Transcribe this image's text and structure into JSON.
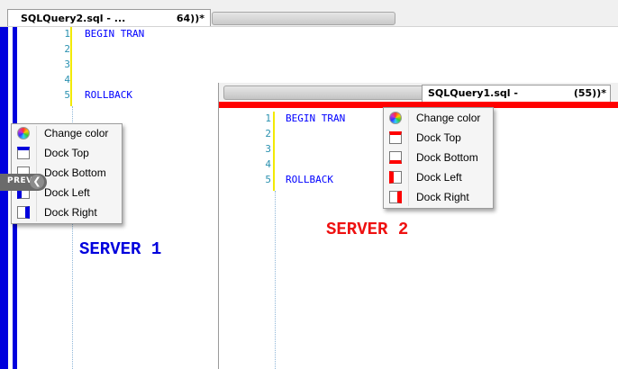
{
  "server1": {
    "tab_title": "SQLQuery2.sql - ...",
    "tab_suffix": "64))*",
    "line_numbers": [
      "1",
      "2",
      "3",
      "4",
      "5"
    ],
    "code_lines": [
      "BEGIN TRAN",
      "",
      "",
      "",
      "ROLLBACK"
    ],
    "label": "SERVER 1",
    "accent_color": "#0000dd"
  },
  "server2": {
    "tab_title": "SQLQuery1.sql -",
    "tab_suffix": "(55))*",
    "line_numbers": [
      "1",
      "2",
      "3",
      "4",
      "5"
    ],
    "code_lines": [
      "BEGIN TRAN",
      "",
      "",
      "",
      "ROLLBACK"
    ],
    "label": "SERVER 2",
    "accent_color": "#ff0000"
  },
  "menu1": {
    "items": [
      {
        "label": "Change color",
        "icon": "color-wheel-icon"
      },
      {
        "label": "Dock Top",
        "icon": "dock-top-icon"
      },
      {
        "label": "Dock Bottom",
        "icon": "dock-bottom-icon"
      },
      {
        "label": "Dock Left",
        "icon": "dock-left-icon"
      },
      {
        "label": "Dock Right",
        "icon": "dock-right-icon"
      }
    ]
  },
  "menu2": {
    "items": [
      {
        "label": "Change color",
        "icon": "color-wheel-icon"
      },
      {
        "label": "Dock Top",
        "icon": "dock-top-icon"
      },
      {
        "label": "Dock Bottom",
        "icon": "dock-bottom-icon"
      },
      {
        "label": "Dock Left",
        "icon": "dock-left-icon"
      },
      {
        "label": "Dock Right",
        "icon": "dock-right-icon"
      }
    ]
  },
  "overlay": {
    "prev_label": "PREV",
    "prev_icon": "chevron-left-icon"
  }
}
